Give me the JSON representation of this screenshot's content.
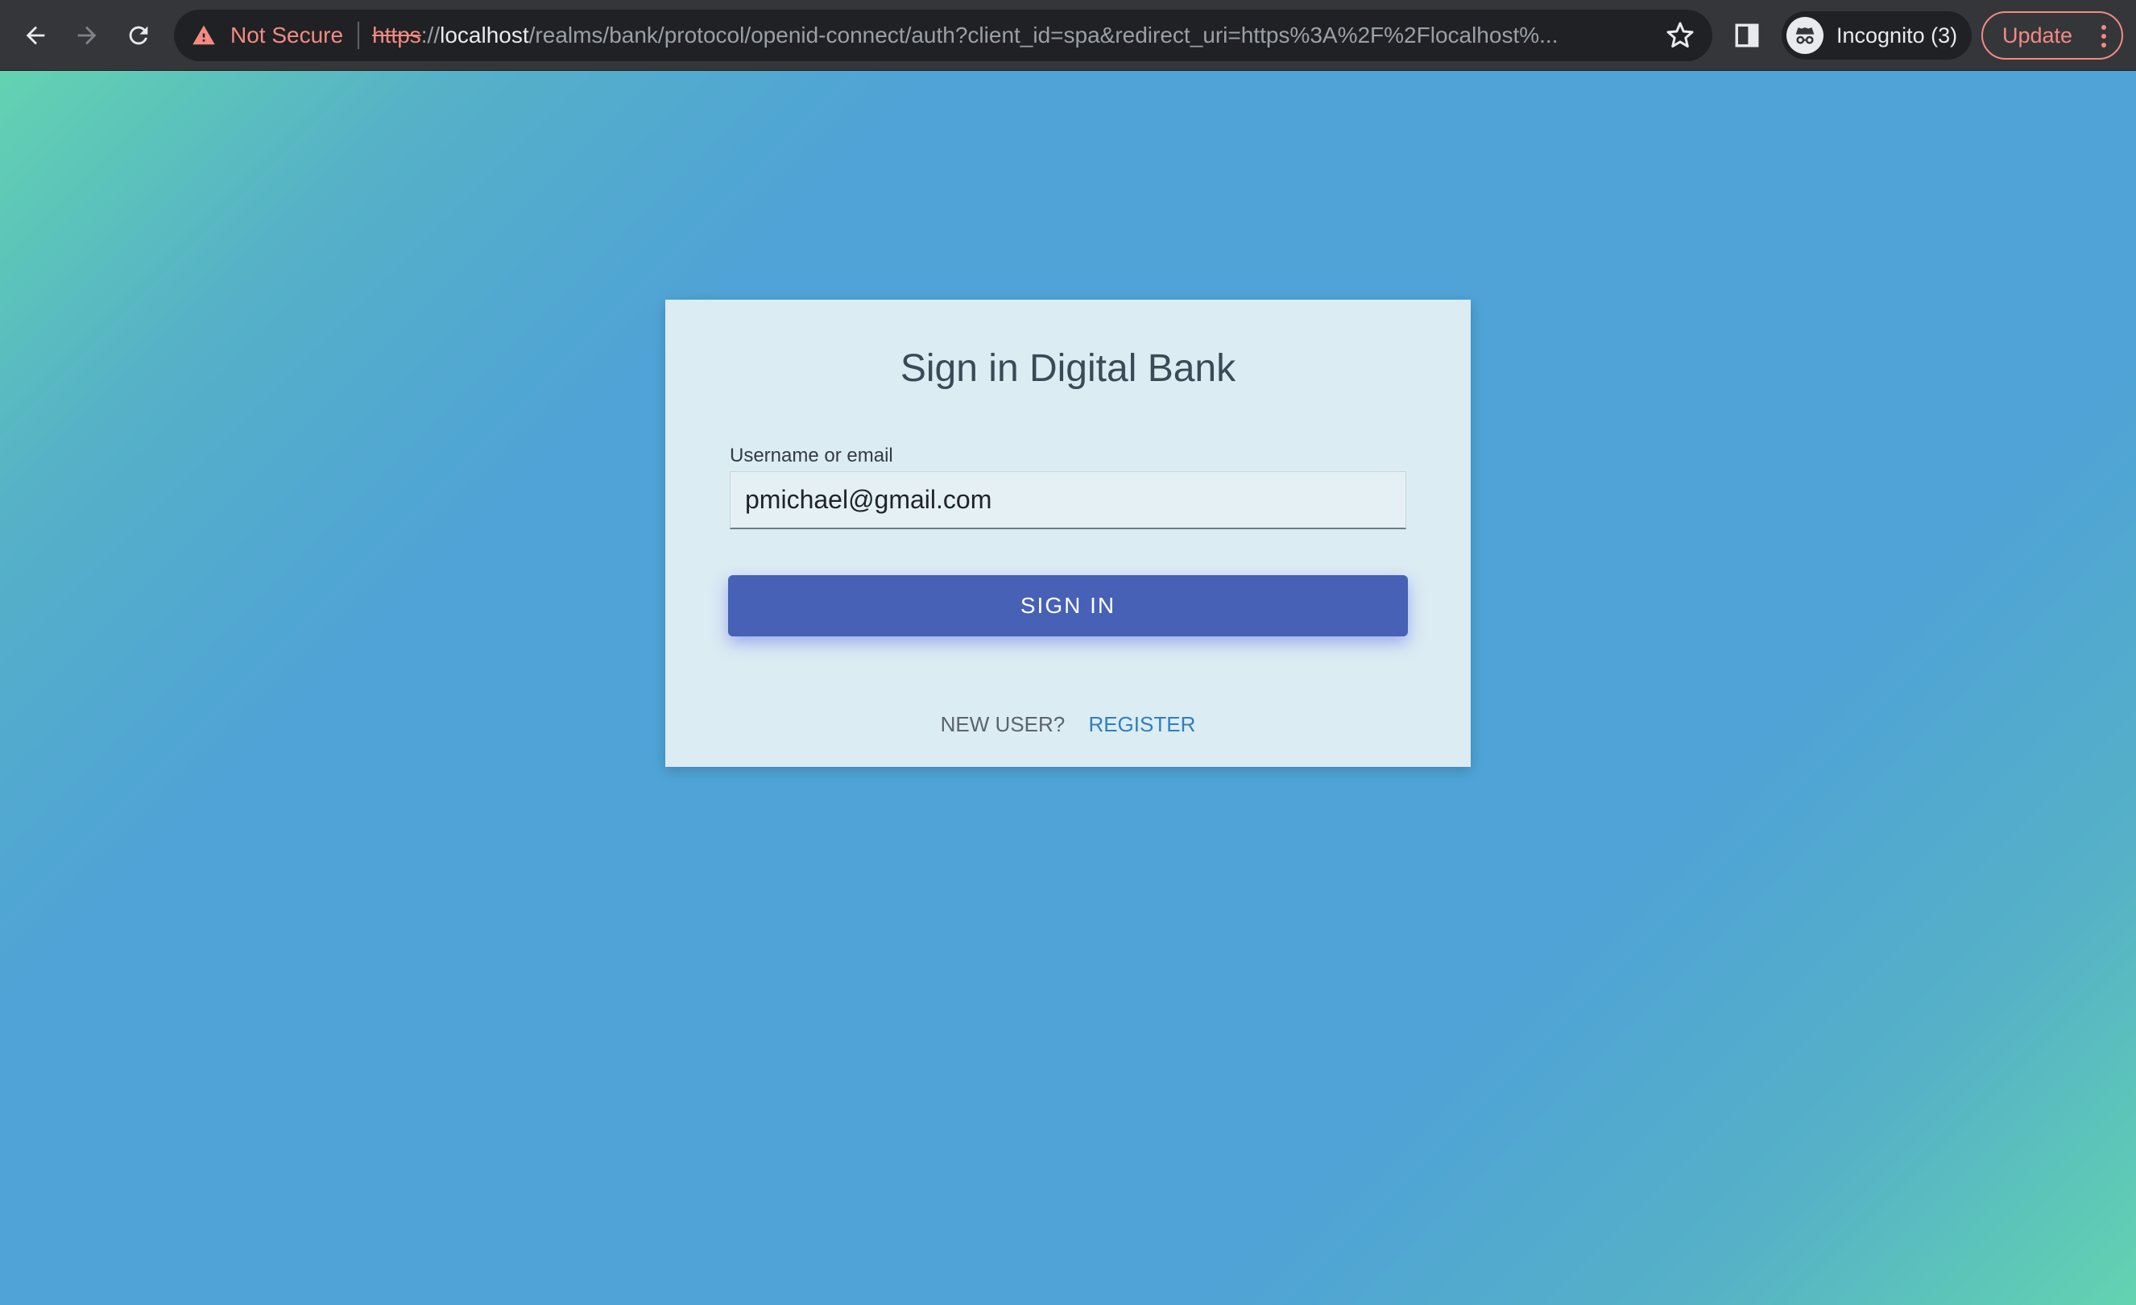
{
  "browser": {
    "security_label": "Not Secure",
    "url_scheme": "https",
    "url_scheme_sep": "://",
    "url_host": "localhost",
    "url_path": "/realms/bank/protocol/openid-connect/auth?client_id=spa&redirect_uri=https%3A%2F%2Flocalhost%...",
    "profile_label": "Incognito (3)",
    "update_label": "Update",
    "icons": [
      "back-arrow-icon",
      "forward-arrow-icon",
      "reload-icon",
      "warning-icon",
      "star-icon",
      "side-panel-icon",
      "incognito-icon",
      "more-vert-icon"
    ]
  },
  "login": {
    "title": "Sign in Digital Bank",
    "username_label": "Username or email",
    "username_value": "pmichael@gmail.com",
    "submit_label": "SIGN IN",
    "new_user_text": "NEW USER?",
    "register_label": "REGISTER"
  },
  "colors": {
    "primary_button": "#4661b6",
    "link": "#2f7fc1",
    "card_background": "#dcecf3",
    "gradient_teal": "#63d3b0",
    "gradient_blue": "#4fa3d6",
    "warning": "#f28b82"
  }
}
